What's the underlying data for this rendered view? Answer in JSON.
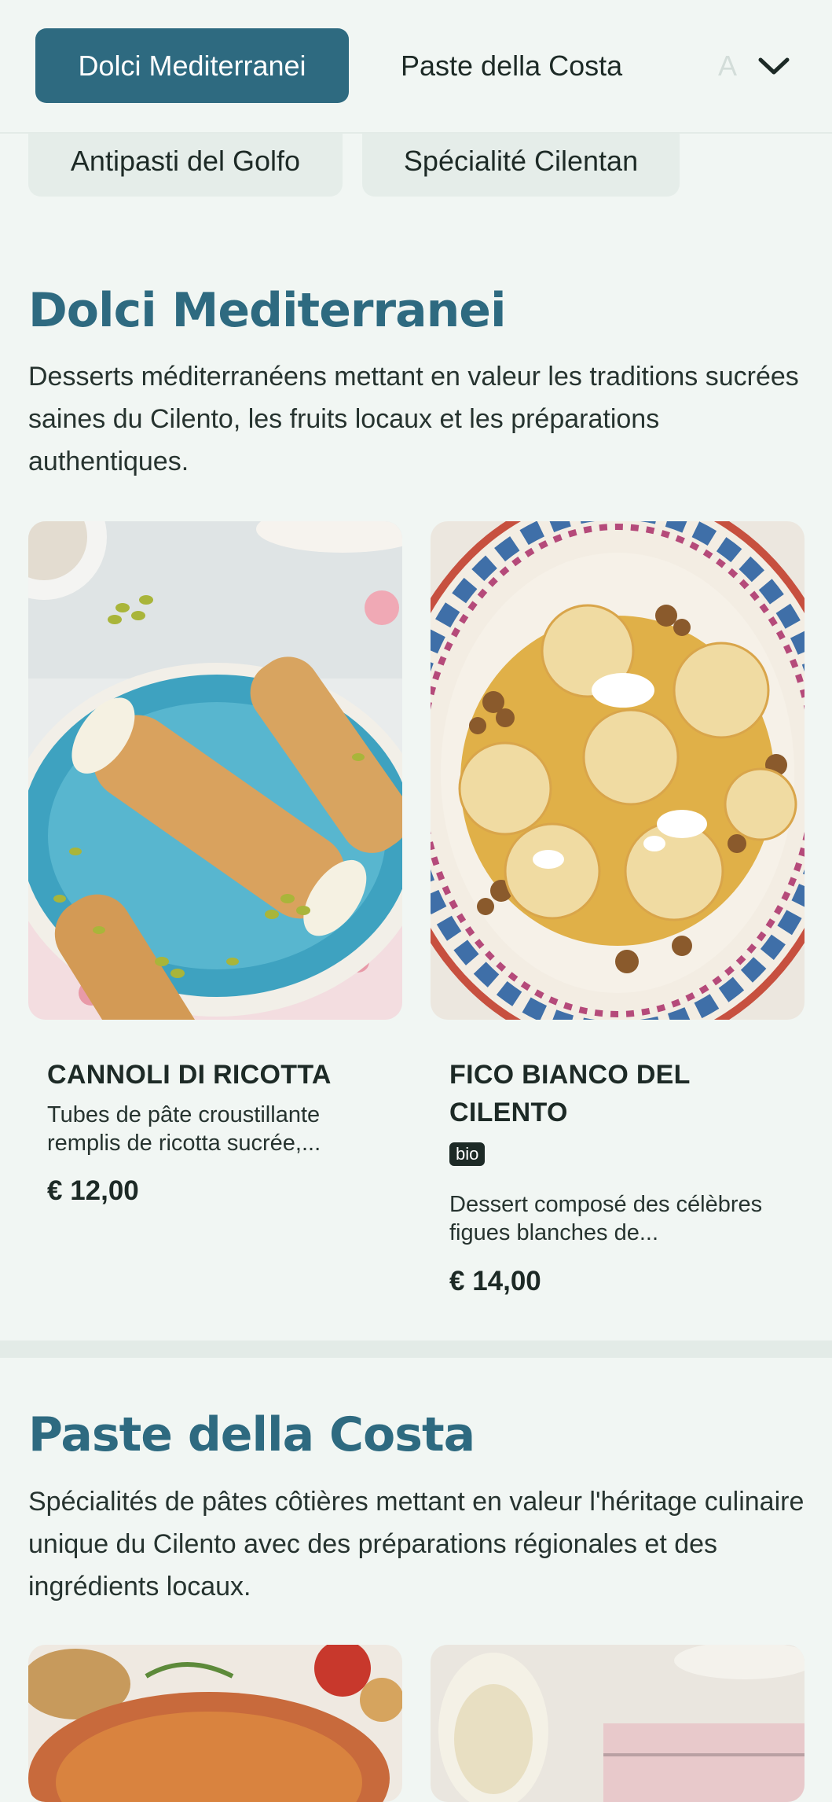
{
  "nav": {
    "tabs": [
      {
        "label": "Dolci Mediterranei",
        "active": true
      },
      {
        "label": "Paste della Costa",
        "active": false
      },
      {
        "label": "A",
        "active": false
      }
    ],
    "chips": [
      "Antipasti del Golfo",
      "Spécialité Cilentan"
    ],
    "expand_icon": "chevron-down-icon"
  },
  "sections": [
    {
      "title": "Dolci Mediterranei",
      "description": "Desserts méditerranéens mettant en valeur les traditions sucrées saines du Cilento, les fruits locaux et les préparations authentiques.",
      "items": [
        {
          "name": "CANNOLI DI RICOTTA",
          "description": "Tubes de pâte croustillante remplis de ricotta sucrée,...",
          "price": "€ 12,00",
          "badge": null
        },
        {
          "name": "FICO BIANCO DEL CILENTO",
          "badge": "bio",
          "description": "Dessert composé des célèbres figues blanches de...",
          "price": "€ 14,00"
        }
      ]
    },
    {
      "title": "Paste della Costa",
      "description": "Spécialités de pâtes côtières mettant en valeur l'héritage culinaire unique du Cilento avec des préparations régionales et des ingrédients locaux."
    }
  ],
  "colors": {
    "accent": "#2e6a80",
    "background": "#f1f6f3",
    "chip": "#e5ede9",
    "text": "#1d2a26"
  }
}
